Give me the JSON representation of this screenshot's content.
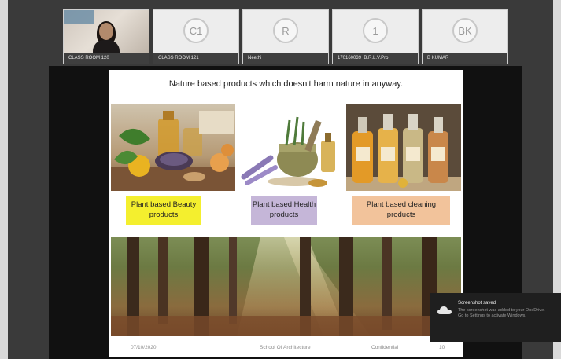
{
  "participants": [
    {
      "name": "CLASS ROOM 120",
      "initials": "",
      "video": true
    },
    {
      "name": "CLASS ROOM 121",
      "initials": "C1",
      "video": false
    },
    {
      "name": "Neethi",
      "initials": "R",
      "video": false
    },
    {
      "name": "170160039_B.R.L.V.Pro",
      "initials": "1",
      "video": false
    },
    {
      "name": "B KUMAR",
      "initials": "BK",
      "video": false
    }
  ],
  "slide": {
    "title": "Nature based products which doesn't harm nature in anyway.",
    "labels": {
      "beauty": "Plant based Beauty products",
      "health": "Plant based Health products",
      "cleaning": "Plant based cleaning products"
    },
    "footer": {
      "date": "07/10/2020",
      "org": "School Of Architecture",
      "conf": "Confidential",
      "page": "10"
    },
    "label_colors": {
      "beauty": "#f4ef2e",
      "health": "#c5b6d8",
      "cleaning": "#f2c39b"
    }
  },
  "toast": {
    "title": "Screenshot saved",
    "message": "The screenshot was added to your OneDrive. Go to Settings to activate Windows.",
    "icon": "cloud-icon"
  }
}
